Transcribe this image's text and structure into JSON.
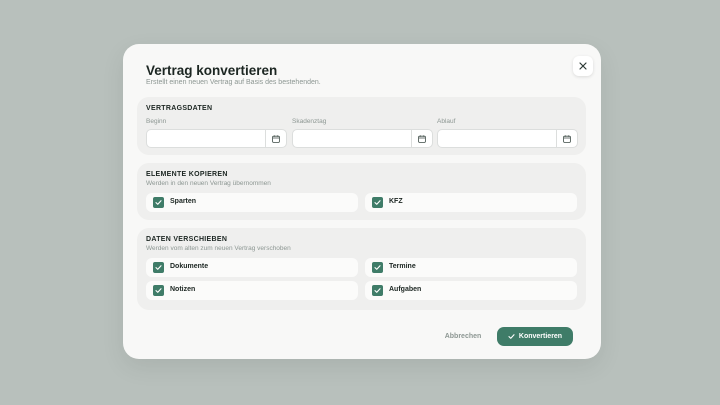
{
  "dialog": {
    "title": "Vertrag konvertieren",
    "subtitle": "Erstellt einen neuen Vertrag auf Basis des bestehenden."
  },
  "vertragsdaten": {
    "title": "VERTRAGSDATEN",
    "fields": [
      {
        "label": "Beginn",
        "value": "",
        "icon": "calendar-icon"
      },
      {
        "label": "Skadenztag",
        "value": "",
        "icon": "calendar-icon"
      },
      {
        "label": "Ablauf",
        "value": "",
        "icon": "calendar-icon"
      }
    ]
  },
  "elemente": {
    "title": "ELEMENTE KOPIEREN",
    "description": "Werden in den neuen Vertrag übernommen",
    "items": [
      {
        "label": "Sparten",
        "checked": true
      },
      {
        "label": "KFZ",
        "checked": true
      }
    ]
  },
  "daten": {
    "title": "DATEN VERSCHIEBEN",
    "description": "Werden vom alten zum neuen Vertrag verschoben",
    "items": [
      {
        "label": "Dokumente",
        "checked": true
      },
      {
        "label": "Termine",
        "checked": true
      },
      {
        "label": "Notizen",
        "checked": true
      },
      {
        "label": "Aufgaben",
        "checked": true
      }
    ]
  },
  "footer": {
    "cancel_label": "Abbrechen",
    "confirm_label": "Konvertieren"
  },
  "colors": {
    "accent": "#3f7c68",
    "backdrop": "#b8c0bc",
    "surface": "#f8f8f7",
    "section": "#efefee"
  }
}
